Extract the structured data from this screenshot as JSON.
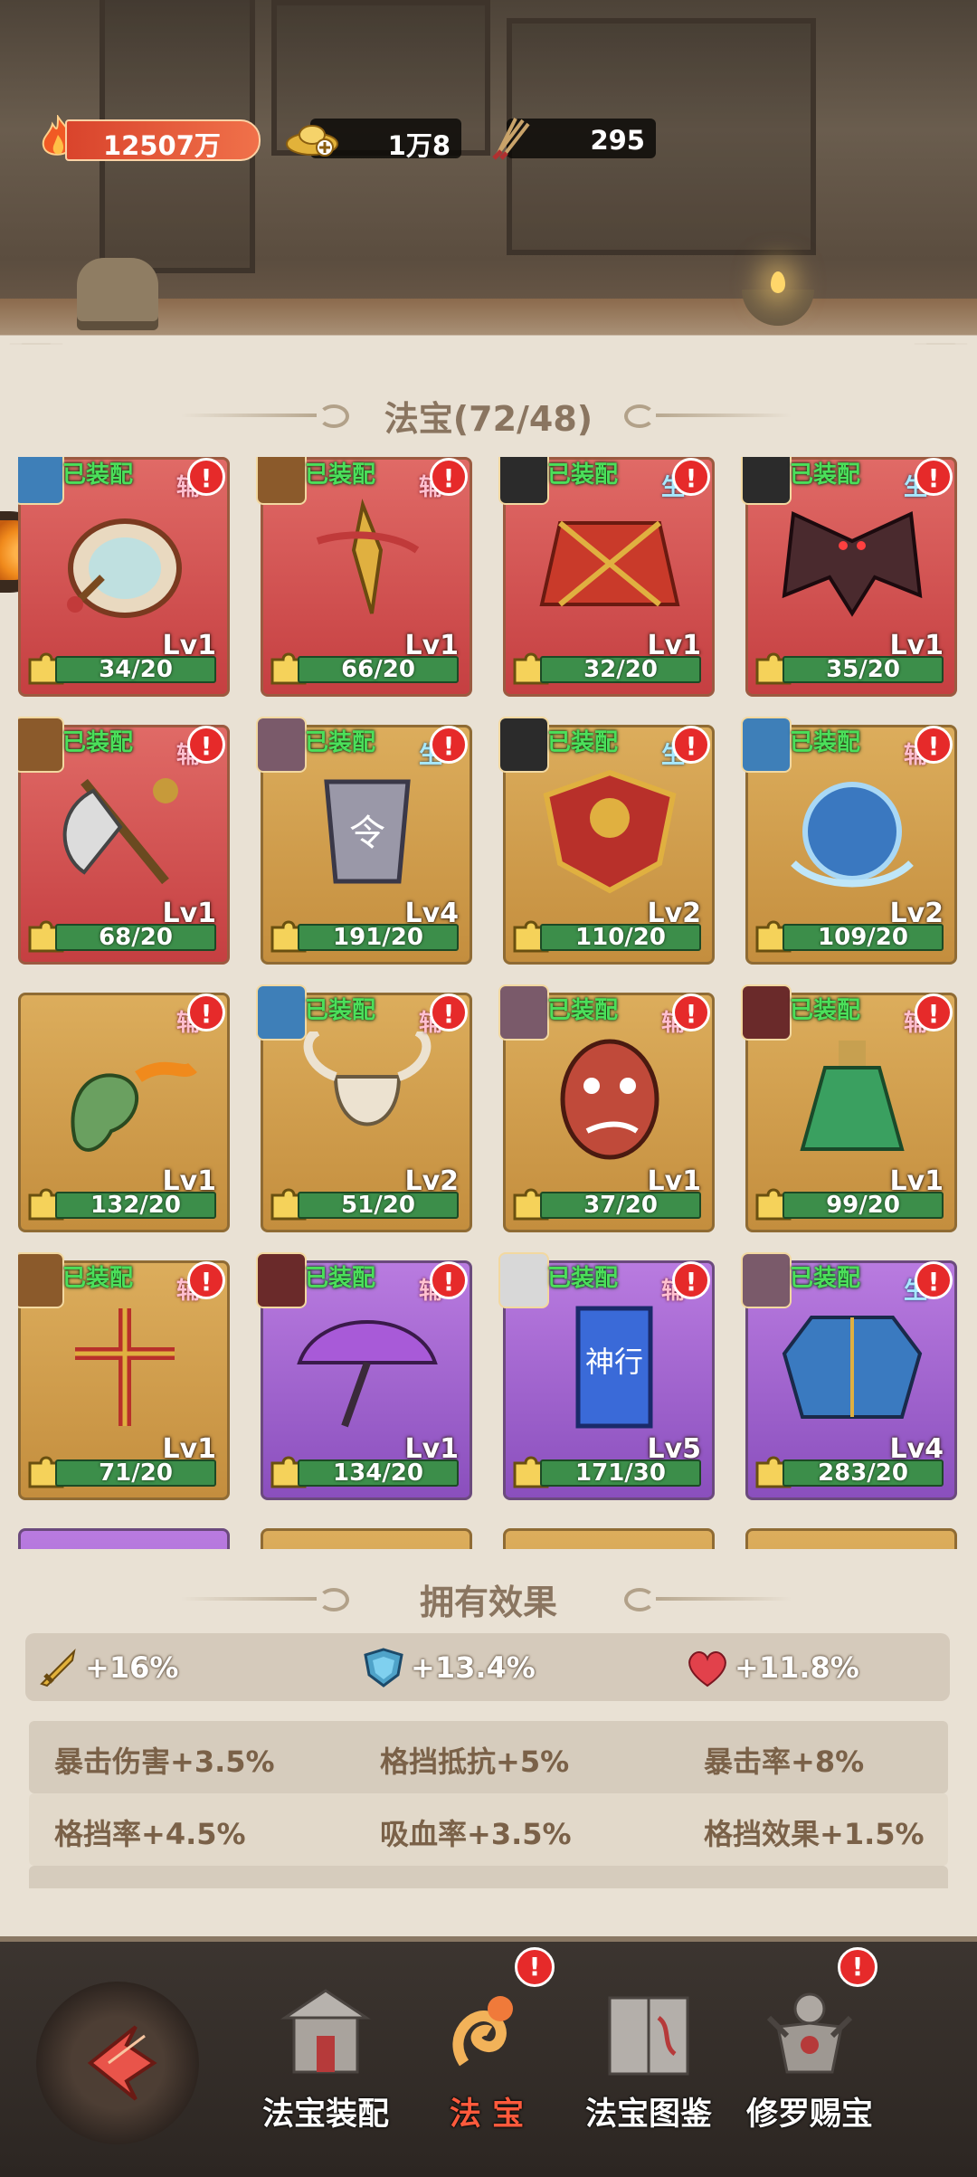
{
  "resources": {
    "power": "12507万",
    "gold": "1万8",
    "arrows": "295"
  },
  "title": "法宝(72/48)",
  "cards": [
    {
      "tag": "已装配",
      "role": "辅",
      "lv": "Lv1",
      "progress": "34/20",
      "bg": "red",
      "art": "drum-icon",
      "portrait": "#3e7fb8"
    },
    {
      "tag": "已装配",
      "role": "辅",
      "lv": "Lv1",
      "progress": "66/20",
      "bg": "red",
      "art": "vajra-dagger-icon",
      "portrait": "#8b5a2b"
    },
    {
      "tag": "已装配",
      "role": "生",
      "lv": "Lv1",
      "progress": "32/20",
      "bg": "red",
      "art": "kasaya-robe-icon",
      "portrait": "#2b2b2b"
    },
    {
      "tag": "已装配",
      "role": "生",
      "lv": "Lv1",
      "progress": "35/20",
      "bg": "red",
      "art": "bat-wings-icon",
      "portrait": "#2b2b2b"
    },
    {
      "tag": "已装配",
      "role": "辅",
      "lv": "Lv1",
      "progress": "68/20",
      "bg": "red",
      "art": "battle-axe-icon",
      "portrait": "#8b5a2b"
    },
    {
      "tag": "已装配",
      "role": "生",
      "lv": "Lv4",
      "progress": "191/20",
      "bg": "gold",
      "art": "amulet-tablet-icon",
      "portrait": "#7a5a6a"
    },
    {
      "tag": "已装配",
      "role": "生",
      "lv": "Lv2",
      "progress": "110/20",
      "bg": "gold",
      "art": "dragon-shield-icon",
      "portrait": "#2b2b2b"
    },
    {
      "tag": "已装配",
      "role": "辅",
      "lv": "Lv2",
      "progress": "109/20",
      "bg": "gold",
      "art": "water-orb-icon",
      "portrait": "#3e7fb8"
    },
    {
      "tag": "",
      "role": "辅",
      "lv": "Lv1",
      "progress": "132/20",
      "bg": "gold",
      "art": "fire-lizard-icon",
      "portrait": ""
    },
    {
      "tag": "已装配",
      "role": "辅",
      "lv": "Lv2",
      "progress": "51/20",
      "bg": "gold",
      "art": "bull-skull-icon",
      "portrait": "#3e7fb8"
    },
    {
      "tag": "已装配",
      "role": "辅",
      "lv": "Lv1",
      "progress": "37/20",
      "bg": "gold",
      "art": "opera-mask-icon",
      "portrait": "#7a5a6a"
    },
    {
      "tag": "已装配",
      "role": "辅",
      "lv": "Lv1",
      "progress": "99/20",
      "bg": "gold",
      "art": "potion-bottle-icon",
      "portrait": "#6a2a2a"
    },
    {
      "tag": "已装配",
      "role": "辅",
      "lv": "Lv1",
      "progress": "71/20",
      "bg": "gold",
      "art": "knot-cross-icon",
      "portrait": "#8b5a2b"
    },
    {
      "tag": "已装配",
      "role": "辅",
      "lv": "Lv1",
      "progress": "134/20",
      "bg": "purple",
      "art": "purple-umbrella-icon",
      "portrait": "#6a2a2a"
    },
    {
      "tag": "已装配",
      "role": "辅",
      "lv": "Lv5",
      "progress": "171/30",
      "bg": "purple",
      "art": "shenxing-banner-icon",
      "portrait": "#d8d8d8",
      "banner": "神行"
    },
    {
      "tag": "已装配",
      "role": "生",
      "lv": "Lv4",
      "progress": "283/20",
      "bg": "purple",
      "art": "blue-robe-icon",
      "portrait": "#7a5a6a"
    }
  ],
  "effects": {
    "title": "拥有效果",
    "summary": [
      {
        "icon": "sword-icon",
        "value": "+16%"
      },
      {
        "icon": "shield-icon",
        "value": "+13.4%"
      },
      {
        "icon": "heart-icon",
        "value": "+11.8%"
      }
    ],
    "rows": [
      [
        "暴击伤害+3.5%",
        "格挡抵抗+5%",
        "暴击率+8%"
      ],
      [
        "格挡率+4.5%",
        "吸血率+3.5%",
        "格挡效果+1.5%"
      ],
      [
        "",
        "",
        ""
      ]
    ]
  },
  "nav": [
    {
      "label": "法宝装配",
      "icon": "shrine-icon",
      "active": false,
      "alert": ""
    },
    {
      "label": "法 宝",
      "icon": "cloud-swirl-icon",
      "active": true,
      "alert": "!"
    },
    {
      "label": "法宝图鉴",
      "icon": "book-icon",
      "active": false,
      "alert": ""
    },
    {
      "label": "修罗赐宝",
      "icon": "asura-icon",
      "active": false,
      "alert": "!"
    }
  ],
  "colors": {
    "accent": "#ff5a3c",
    "tag_green": "#4bdf5a",
    "bar_green": "#3c8e4a",
    "alert_red": "#e62a2a"
  }
}
